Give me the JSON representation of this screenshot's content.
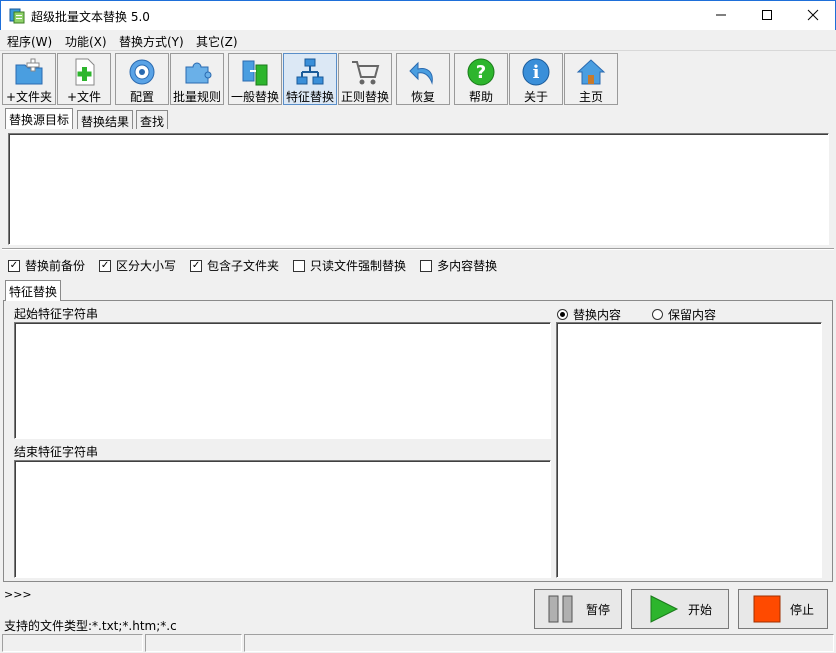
{
  "window": {
    "title": "超级批量文本替换 5.0"
  },
  "menu": [
    "程序(W)",
    "功能(X)",
    "替换方式(Y)",
    "其它(Z)"
  ],
  "toolbar": {
    "add_folder": "+文件夹",
    "add_file": "+文件",
    "config": "配置",
    "batch_rules": "批量规则",
    "general_replace": "一般替换",
    "feature_replace": "特征替换",
    "regex_replace": "正则替换",
    "restore": "恢复",
    "help": "帮助",
    "about": "关于",
    "home": "主页"
  },
  "top_tabs": [
    "替换源目标",
    "替换结果",
    "查找"
  ],
  "options": [
    {
      "label": "替换前备份",
      "checked": true
    },
    {
      "label": "区分大小写",
      "checked": true
    },
    {
      "label": "包含子文件夹",
      "checked": true
    },
    {
      "label": "只读文件强制替换",
      "checked": false
    },
    {
      "label": "多内容替换",
      "checked": false
    }
  ],
  "feature_tab": "特征替换",
  "start_label": "起始特征字符串",
  "end_label": "结束特征字符串",
  "radio_replace": "替换内容",
  "radio_keep": "保留内容",
  "prompt": ">>>",
  "file_types": "支持的文件类型:*.txt;*.htm;*.c",
  "buttons": {
    "pause": "暂停",
    "start": "开始",
    "stop": "停止"
  },
  "colors": {
    "accent": "#1e6fd9",
    "start": "#2db52d",
    "stop": "#ff4a00"
  }
}
